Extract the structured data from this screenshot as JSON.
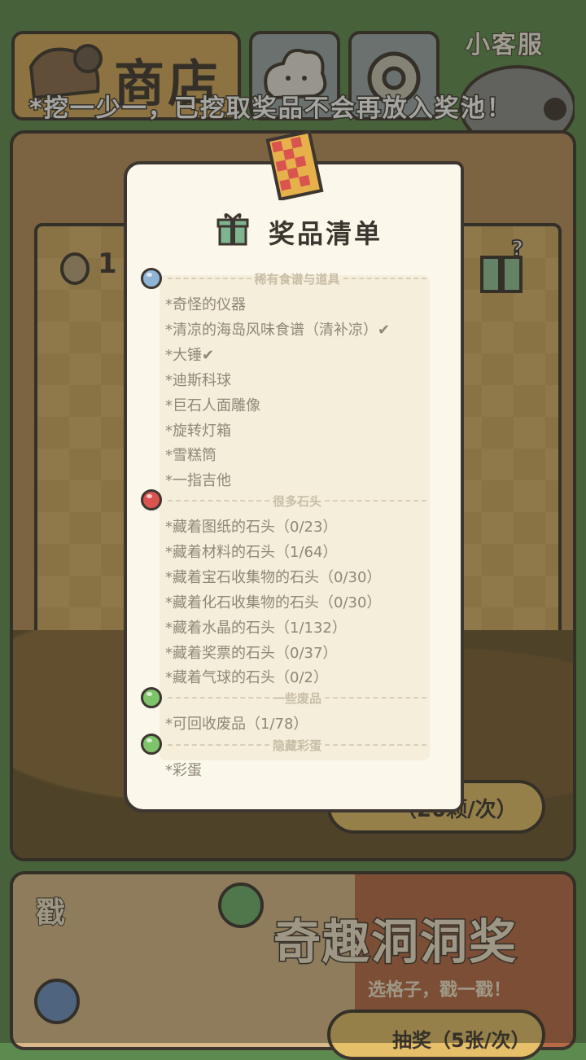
{
  "header": {
    "shop_label": "商店",
    "support_label": "小客服",
    "banner": "*挖一少一，已挖取奖品不会再放入奖池！"
  },
  "dig_card": {
    "coin_count": "1",
    "dig_button": "（20颗/次）"
  },
  "lottery": {
    "stamp": "戳",
    "title": "奇趣洞洞奖",
    "subtitle": "选格子，戳一戳！",
    "draw_button": "抽奖（5张/次）"
  },
  "modal": {
    "title": "奖品清单",
    "sections": [
      {
        "heading": "稀有食谱与道具",
        "dot_color": "#8fb5d6",
        "items": [
          {
            "text": "*奇怪的仪器",
            "checked": false
          },
          {
            "text": "*清凉的海岛风味食谱（清补凉）",
            "checked": true
          },
          {
            "text": "*大锤",
            "checked": true
          },
          {
            "text": "*迪斯科球",
            "checked": false
          },
          {
            "text": "*巨石人面雕像",
            "checked": false
          },
          {
            "text": "*旋转灯箱",
            "checked": false
          },
          {
            "text": "*雪糕筒",
            "checked": false
          },
          {
            "text": "*一指吉他",
            "checked": false
          }
        ]
      },
      {
        "heading": "很多石头",
        "dot_color": "#d9534f",
        "items": [
          {
            "text": "*藏着图纸的石头（0/23）",
            "checked": false
          },
          {
            "text": "*藏着材料的石头（1/64）",
            "checked": false
          },
          {
            "text": "*藏着宝石收集物的石头（0/30）",
            "checked": false
          },
          {
            "text": "*藏着化石收集物的石头（0/30）",
            "checked": false
          },
          {
            "text": "*藏着水晶的石头（1/132）",
            "checked": false
          },
          {
            "text": "*藏着奖票的石头（0/37）",
            "checked": false
          },
          {
            "text": "*藏着气球的石头（0/2）",
            "checked": false
          }
        ]
      },
      {
        "heading": "一些废品",
        "dot_color": "#7ec46a",
        "items": [
          {
            "text": "*可回收废品（1/78）",
            "checked": false
          }
        ]
      },
      {
        "heading": "隐藏彩蛋",
        "dot_color": "#7ec46a",
        "items": [
          {
            "text": "*彩蛋",
            "checked": false
          }
        ]
      }
    ],
    "check_mark": "✔"
  }
}
